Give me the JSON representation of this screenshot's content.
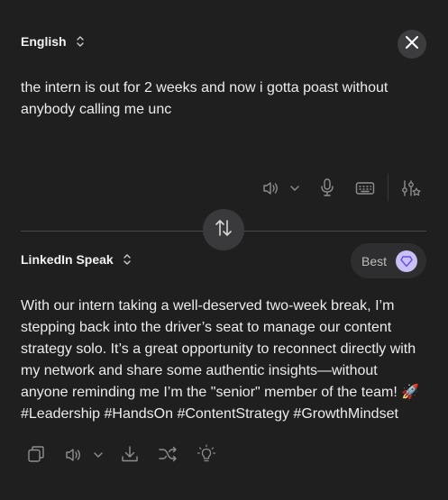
{
  "source": {
    "language": "English",
    "text": "the intern is out for 2 weeks and now i gotta poast without anybody calling me unc"
  },
  "target": {
    "language": "LinkedIn Speak",
    "best_label": "Best",
    "text": "With our intern taking a well-deserved two-week break, I’m stepping back into the driver’s seat to manage our content strategy solo. It’s a great opportunity to reconnect directly with my network and share some authentic insights—without anyone reminding me I’m the \"senior\" member of the team! 🚀 #Leadership #HandsOn #ContentStrategy #GrowthMindset"
  },
  "icons": {
    "source_toolbar": [
      "speaker-icon",
      "chevron-down-icon",
      "microphone-icon",
      "keyboard-icon",
      "settings-sliders-icon"
    ],
    "target_toolbar": [
      "copy-icon",
      "speaker-icon",
      "chevron-down-icon",
      "download-icon",
      "shuffle-icon",
      "lightbulb-icon"
    ]
  },
  "colors": {
    "background": "#1f1f1f",
    "text": "#ececec",
    "icon": "#8f8f8f",
    "button_bg": "#3a3a3c",
    "best_badge": "#c8c0f6",
    "best_badge_icon": "#6b4fd8"
  }
}
